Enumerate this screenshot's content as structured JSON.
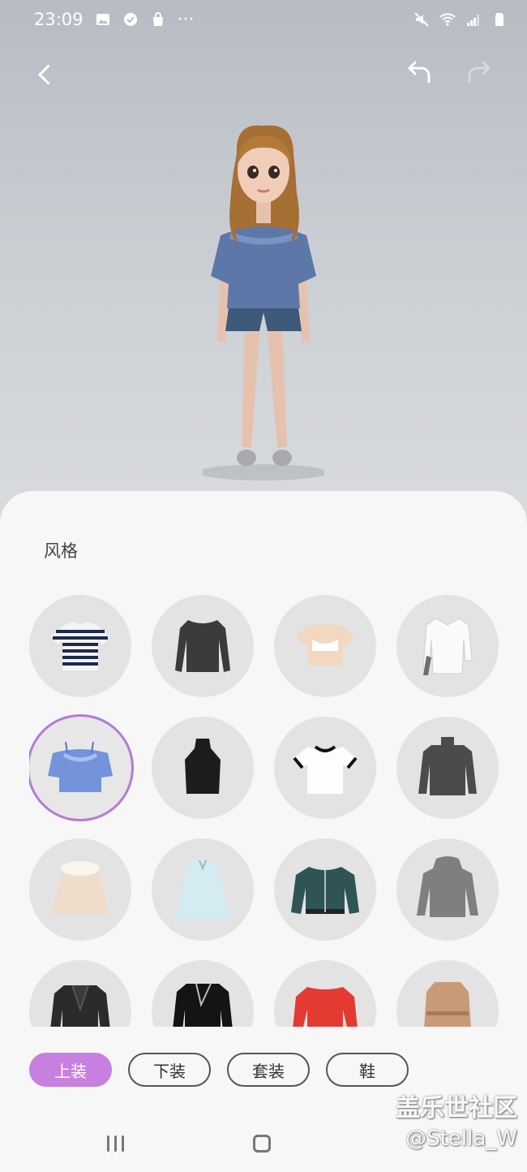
{
  "status_bar": {
    "time": "23:09",
    "left_icons": [
      "image-icon",
      "check-badge-icon",
      "shopping-bag-icon"
    ],
    "more": "···",
    "right_icons": [
      "mute-icon",
      "wifi-icon",
      "signal-icon",
      "battery-icon"
    ]
  },
  "toolbar": {
    "back": "back-icon",
    "undo": "undo-icon",
    "redo": "redo-icon"
  },
  "sheet": {
    "section_title": "风格",
    "items": [
      {
        "name": "striped-tee",
        "selected": false
      },
      {
        "name": "dark-knit-sweater",
        "selected": false
      },
      {
        "name": "cream-crop-top",
        "selected": false
      },
      {
        "name": "white-shirt",
        "selected": false
      },
      {
        "name": "blue-off-shoulder-top",
        "selected": true
      },
      {
        "name": "black-halter-top",
        "selected": false
      },
      {
        "name": "white-ringer-tee",
        "selected": false
      },
      {
        "name": "gray-turtleneck",
        "selected": false
      },
      {
        "name": "fur-collar-coat",
        "selected": false
      },
      {
        "name": "light-blue-tunic",
        "selected": false
      },
      {
        "name": "green-bomber",
        "selected": false
      },
      {
        "name": "gray-hoodie",
        "selected": false
      },
      {
        "name": "black-blazer",
        "selected": false
      },
      {
        "name": "leather-jacket",
        "selected": false
      },
      {
        "name": "red-sweater",
        "selected": false
      },
      {
        "name": "trench-coat",
        "selected": false
      }
    ]
  },
  "tabs": [
    {
      "label": "上装",
      "active": true
    },
    {
      "label": "下装",
      "active": false
    },
    {
      "label": "套装",
      "active": false
    },
    {
      "label": "鞋",
      "active": false
    }
  ],
  "colors": {
    "accent": "#c77fe0",
    "sheet_bg": "#f7f7f7",
    "item_bg": "#e3e3e3"
  },
  "watermark": {
    "line1": "盖乐世社区",
    "line2": "@Stella_W"
  }
}
